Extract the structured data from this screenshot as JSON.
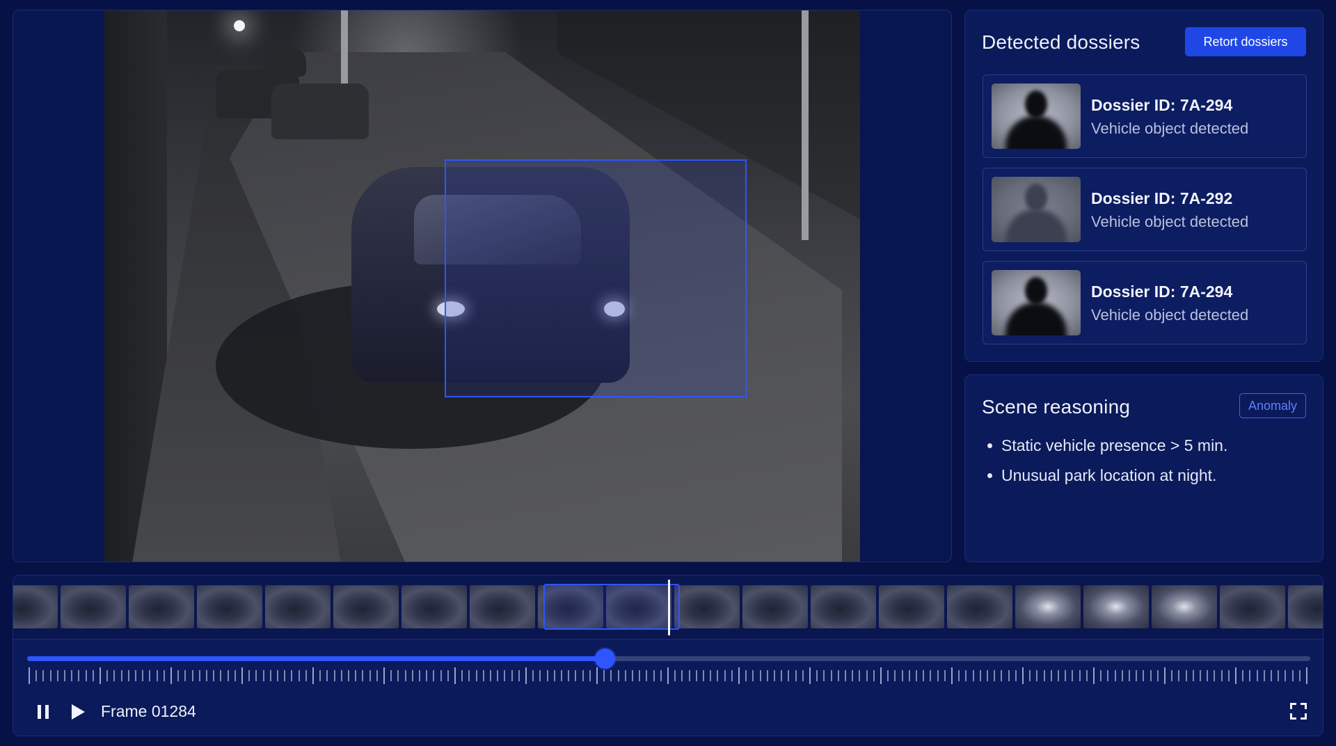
{
  "dossiers": {
    "title": "Detected dossiers",
    "action_label": "Retort dossiers",
    "items": [
      {
        "id_label": "Dossier ID: 7A-294",
        "description": "Vehicle object detected"
      },
      {
        "id_label": "Dossier ID: 7A-292",
        "description": "Vehicle object detected"
      },
      {
        "id_label": "Dossier ID: 7A-294",
        "description": "Vehicle object detected"
      }
    ]
  },
  "scene": {
    "title": "Scene reasoning",
    "badge": "Anomaly",
    "reasons": [
      "Static vehicle presence > 5 min.",
      "Unusual park location at night."
    ]
  },
  "player": {
    "frame_label": "Frame 01284",
    "progress": 0.45,
    "icons": {
      "pause": "pause-icon",
      "play": "play-icon",
      "fullscreen": "fullscreen-icon"
    }
  },
  "colors": {
    "background": "#061245",
    "panel": "#0b1a5a",
    "accent": "#2f55ff",
    "button": "#1f47e6"
  }
}
